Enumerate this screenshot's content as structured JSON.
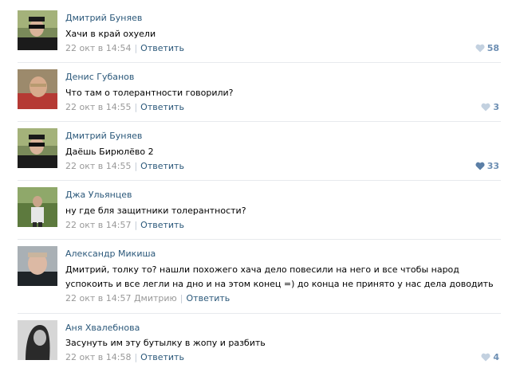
{
  "comments": [
    {
      "author": "Дмитрий Буняев",
      "text": "Хачи в край охуели",
      "date": "22 окт в 14:54",
      "to": "",
      "reply": "Ответить",
      "likes": "58",
      "liked": false
    },
    {
      "author": "Денис Губанов",
      "text": "Что там о толерантности говорили?",
      "date": "22 окт в 14:55",
      "to": "",
      "reply": "Ответить",
      "likes": "3",
      "liked": false
    },
    {
      "author": "Дмитрий Буняев",
      "text": "Даёшь Бирюлёво 2",
      "date": "22 окт в 14:55",
      "to": "",
      "reply": "Ответить",
      "likes": "33",
      "liked": true
    },
    {
      "author": "Джа Ульянцев",
      "text": "ну где бля защитники толерантности?",
      "date": "22 окт в 14:57",
      "to": "",
      "reply": "Ответить",
      "likes": "",
      "liked": false
    },
    {
      "author": "Александр Микиша",
      "text_line1": "Дмитрий, толку то? нашли похожего хача дело повесили на него и все чтобы народ",
      "text_line2": "успокоить и все легли на дно и на этом конец =) до конца не принято у нас дела доводить",
      "date": "22 окт в 14:57",
      "to": "Дмитрию",
      "reply": "Ответить",
      "likes": "",
      "liked": false
    },
    {
      "author": "Аня Хвалебнова",
      "text": "Засунуть им эту бутылку в жопу и разбить",
      "date": "22 окт в 14:58",
      "to": "",
      "reply": "Ответить",
      "likes": "4",
      "liked": false
    }
  ],
  "colors": {
    "link": "#2b587a",
    "meta": "#999999",
    "like": "#6d8fb3",
    "like_active": "#5b7fa6",
    "divider": "#e7eaed"
  },
  "icons": {
    "like": "heart-icon"
  }
}
